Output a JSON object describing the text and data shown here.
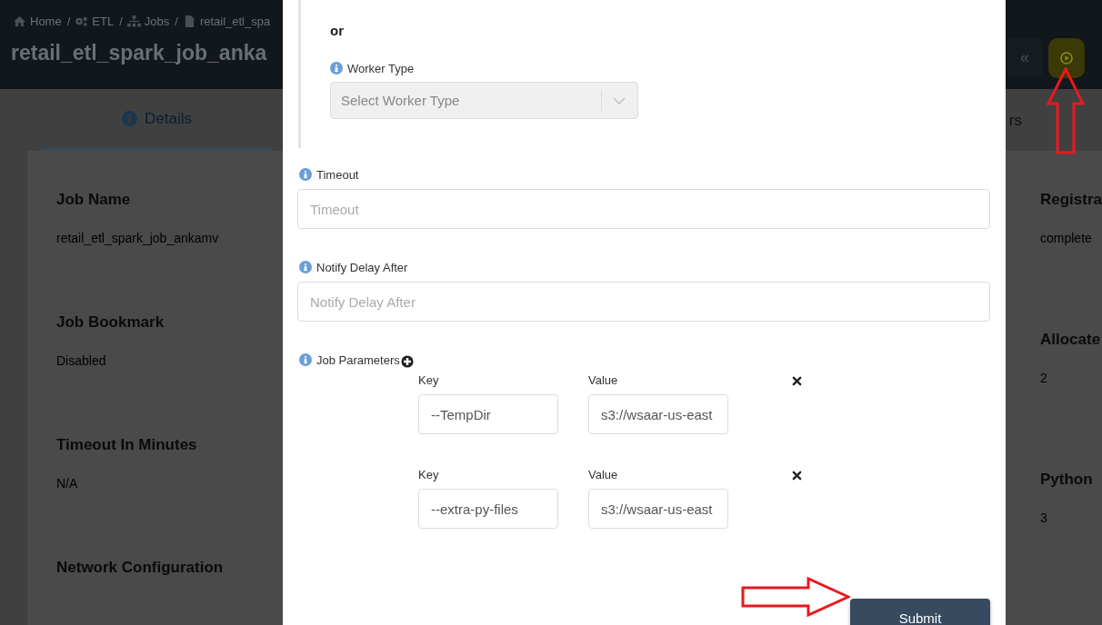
{
  "breadcrumb": [
    {
      "kind": "home",
      "label": "Home",
      "separator": "/"
    },
    {
      "kind": "gears",
      "label": "ETL",
      "separator": "/"
    },
    {
      "kind": "sitemap",
      "label": "Jobs",
      "separator": "/"
    },
    {
      "kind": "file",
      "label": "retail_etl_spa"
    }
  ],
  "page_title": "retail_etl_spark_job_anka",
  "header_buttons": [
    {
      "kind": "back",
      "label": "«"
    },
    {
      "kind": "run"
    }
  ],
  "tabs": [
    {
      "label": "Details",
      "selected": true,
      "icon": true
    },
    {
      "label": "rs",
      "selected": false,
      "icon": false
    }
  ],
  "left_fields": [
    {
      "label": "Job Name",
      "value": "retail_etl_spark_job_ankamv"
    },
    {
      "label": "Job Bookmark",
      "value": "Disabled"
    },
    {
      "label": "Timeout In Minutes",
      "value": "N/A"
    },
    {
      "label": "Network Configuration"
    }
  ],
  "right_fields": [
    {
      "label": "Registra",
      "value": "complete"
    },
    {
      "label": "Allocate",
      "value": "2"
    },
    {
      "label": "Python",
      "value": "3"
    }
  ],
  "modal": {
    "separator_text": "or",
    "worker_type": {
      "label": "Worker Type",
      "placeholder": "Select Worker Type",
      "disabled": true
    },
    "inputs": [
      {
        "label": "Timeout",
        "placeholder": "Timeout"
      },
      {
        "label": "Notify Delay After",
        "placeholder": "Notify Delay After"
      }
    ],
    "job_parameters": {
      "label": "Job Parameters",
      "rows": [
        {
          "key_label": "Key",
          "key": "--TempDir",
          "value_label": "Value",
          "value": "s3://wsaar-us-east"
        },
        {
          "key_label": "Key",
          "key": "--extra-py-files",
          "value_label": "Value",
          "value": "s3://wsaar-us-east"
        }
      ]
    },
    "submit": "Submit"
  },
  "annotations": [
    {
      "kind": "arrow_up"
    },
    {
      "kind": "arrow_right"
    }
  ]
}
